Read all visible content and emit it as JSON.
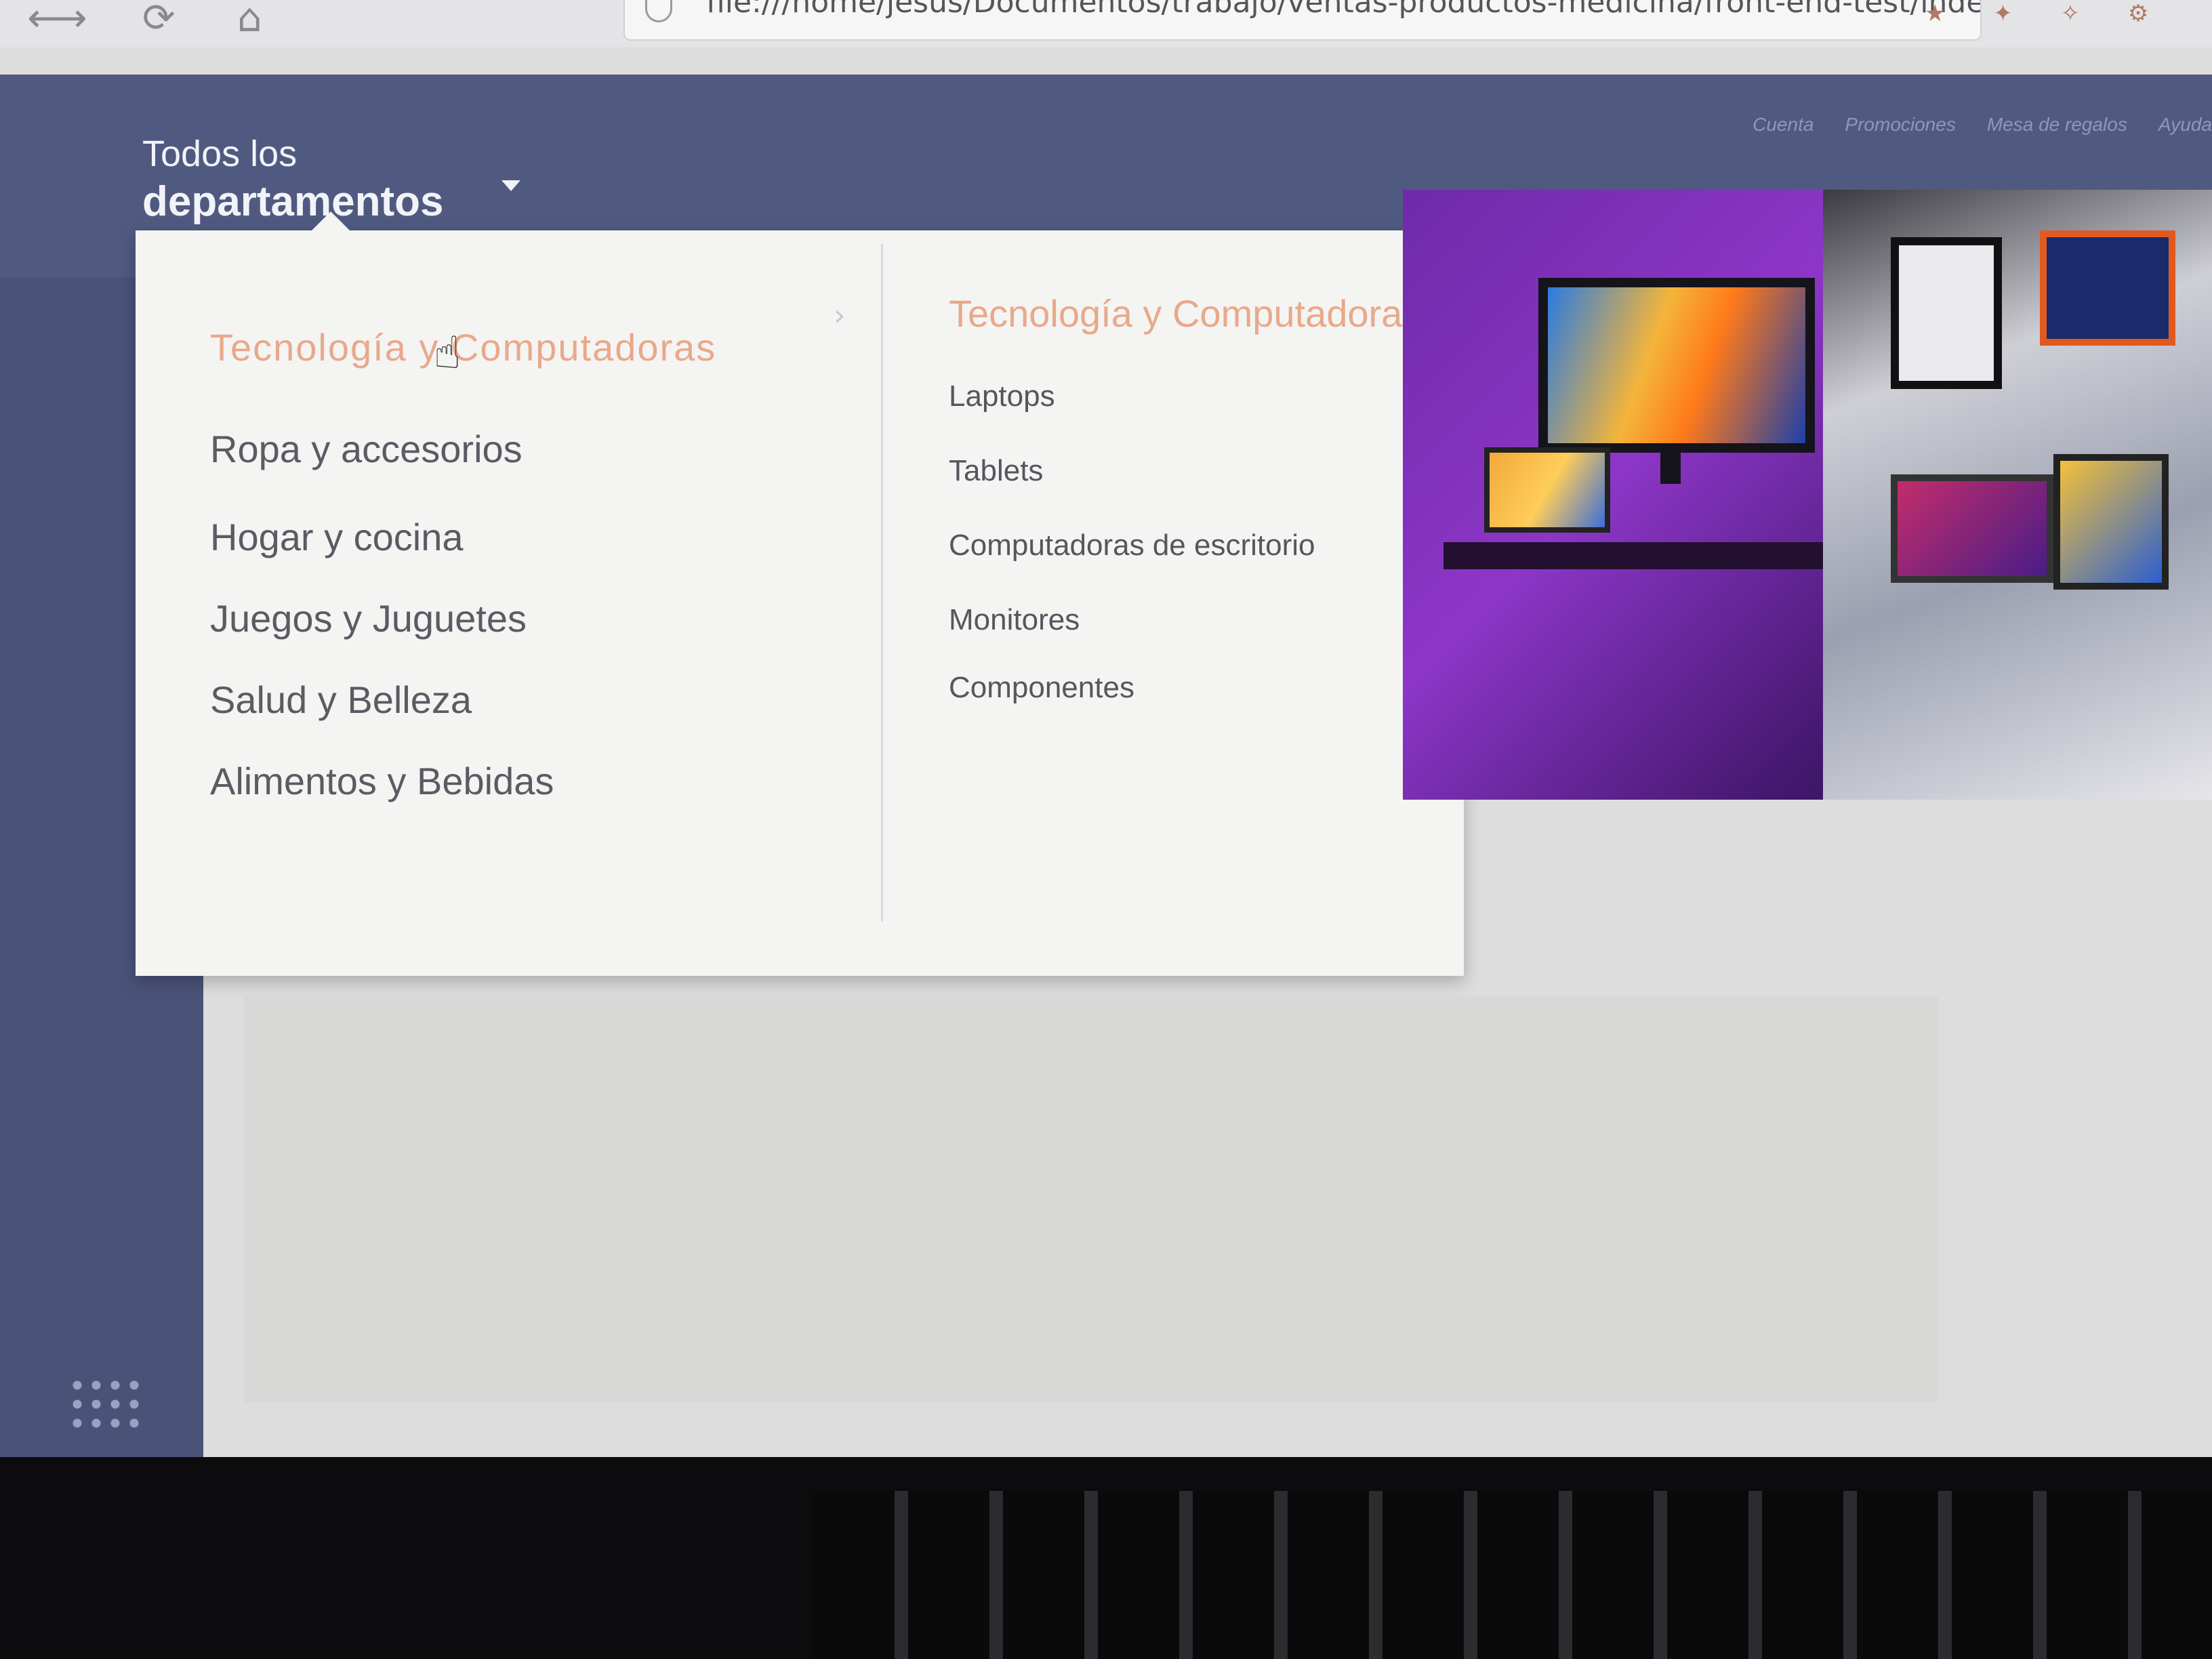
{
  "browser": {
    "back_glyph": "←",
    "forward_glyph": "→",
    "reload_glyph": "⟳",
    "home_glyph": "⌂",
    "url": "file:///home/jesus/Documentos/trabajo/ventas-productos-medicina/front-end-test/index.h"
  },
  "header": {
    "departments_line1": "Todos los",
    "departments_line2": "departamentos",
    "top_links": [
      "Cuenta",
      "Promociones",
      "Mesa de regalos",
      "Ayuda"
    ]
  },
  "departments": [
    {
      "label": "Tecnología y Computadoras",
      "active": true
    },
    {
      "label": "Ropa y accesorios",
      "active": false
    },
    {
      "label": "Hogar y cocina",
      "active": false
    },
    {
      "label": "Juegos y Juguetes",
      "active": false
    },
    {
      "label": "Salud y Belleza",
      "active": false
    },
    {
      "label": "Alimentos y Bebidas",
      "active": false
    }
  ],
  "submenu": {
    "title": "Tecnología y Computadoras",
    "items": [
      "Laptops",
      "Tablets",
      "Computadoras de escritorio",
      "Monitores",
      "Componentes"
    ]
  },
  "colors": {
    "navbar": "#505a80",
    "accent": "#e8a98a",
    "dropdown_bg": "#f4f4f3",
    "banner_purple": "#8d36c8"
  },
  "icons": {
    "chevron": "›",
    "cursor": "☝"
  }
}
